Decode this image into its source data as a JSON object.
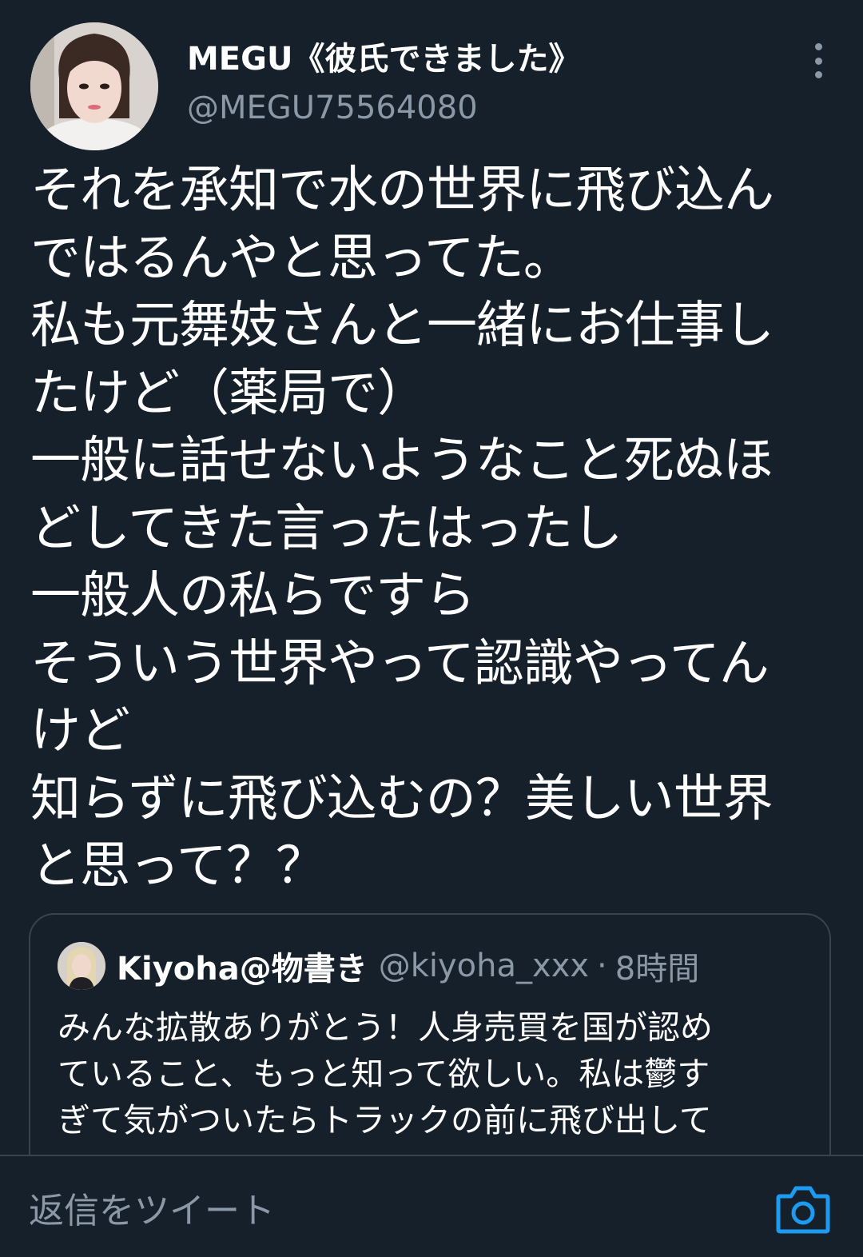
{
  "tweet": {
    "author": {
      "display_name": "MEGU《彼氏できました》",
      "handle": "@MEGU75564080",
      "avatar": "profile-photo"
    },
    "more_icon": "more-vertical-icon",
    "text_lines": [
      "それを承知で水の世界に飛び込ん",
      "ではるんやと思ってた。",
      "私も元舞妓さんと一緒にお仕事し",
      "たけど（薬局で）",
      "一般に話せないようなこと死ぬほ",
      "どしてきた言ったはったし",
      "一般人の私らですら",
      "そういう世界やって認識やってん",
      "けど",
      "知らずに飛び込むの？美しい世界",
      "と思って？？"
    ]
  },
  "quoted_tweet": {
    "author": {
      "display_name": "Kiyoha@物書き",
      "handle": "@kiyoha_xxx",
      "separator": "·",
      "time": "8時間"
    },
    "text_lines": [
      "みんな拡散ありがとう！人身売買を国が認め",
      "ていること、もっと知って欲しい。私は鬱す",
      "ぎて気がついたらトラックの前に飛び出して"
    ]
  },
  "reply_bar": {
    "placeholder": "返信をツイート",
    "camera_icon": "camera-icon",
    "accent_color": "#1d9bf0"
  },
  "colors": {
    "background": "#15202b",
    "primary_text": "#ffffff",
    "secondary_text": "#8b98a5",
    "border": "#38444d"
  }
}
